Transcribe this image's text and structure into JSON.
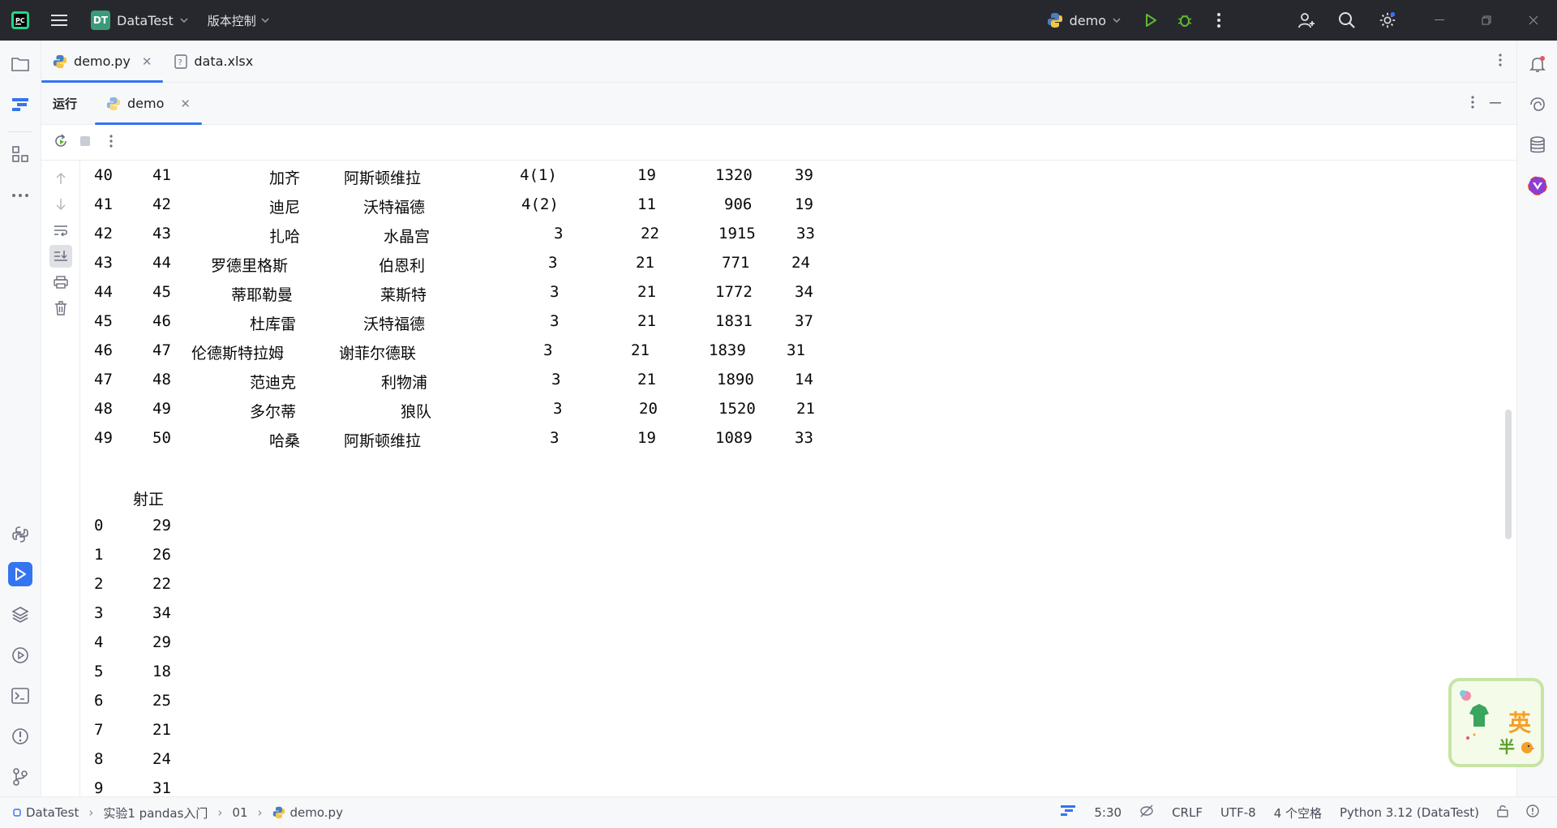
{
  "titlebar": {
    "project_badge": "DT",
    "project_name": "DataTest",
    "vcs_label": "版本控制",
    "run_config": "demo"
  },
  "editor_tabs": [
    {
      "label": "demo.py",
      "icon": "python-file-icon",
      "active": true
    },
    {
      "label": "data.xlsx",
      "icon": "unknown-file-icon",
      "active": false
    }
  ],
  "run_panel": {
    "title": "运行",
    "tab_label": "demo"
  },
  "console": {
    "table_rows": [
      {
        "idx": "40",
        "no": "41",
        "player": "加齐",
        "club": "阿斯顿维拉",
        "pos": "4(1)",
        "age": "19",
        "val": "1320",
        "last": "39"
      },
      {
        "idx": "41",
        "no": "42",
        "player": "迪尼",
        "club": "沃特福德",
        "pos": "4(2)",
        "age": "11",
        "val": "906",
        "last": "19"
      },
      {
        "idx": "42",
        "no": "43",
        "player": "扎哈",
        "club": "水晶宫",
        "pos": "3",
        "age": "22",
        "val": "1915",
        "last": "33"
      },
      {
        "idx": "43",
        "no": "44",
        "player": "罗德里格斯",
        "club": "伯恩利",
        "pos": "3",
        "age": "21",
        "val": "771",
        "last": "24"
      },
      {
        "idx": "44",
        "no": "45",
        "player": "蒂耶勒曼",
        "club": "莱斯特",
        "pos": "3",
        "age": "21",
        "val": "1772",
        "last": "34"
      },
      {
        "idx": "45",
        "no": "46",
        "player": "杜库雷",
        "club": "沃特福德",
        "pos": "3",
        "age": "21",
        "val": "1831",
        "last": "37"
      },
      {
        "idx": "46",
        "no": "47",
        "player": "伦德斯特拉姆",
        "club": "谢菲尔德联",
        "pos": "3",
        "age": "21",
        "val": "1839",
        "last": "31"
      },
      {
        "idx": "47",
        "no": "48",
        "player": "范迪克",
        "club": "利物浦",
        "pos": "3",
        "age": "21",
        "val": "1890",
        "last": "14"
      },
      {
        "idx": "48",
        "no": "49",
        "player": "多尔蒂",
        "club": "狼队",
        "pos": "3",
        "age": "20",
        "val": "1520",
        "last": "21"
      },
      {
        "idx": "49",
        "no": "50",
        "player": "哈桑",
        "club": "阿斯顿维拉",
        "pos": "3",
        "age": "19",
        "val": "1089",
        "last": "33"
      }
    ],
    "series_header": "射正",
    "series_rows": [
      {
        "idx": "0",
        "val": "29"
      },
      {
        "idx": "1",
        "val": "26"
      },
      {
        "idx": "2",
        "val": "22"
      },
      {
        "idx": "3",
        "val": "34"
      },
      {
        "idx": "4",
        "val": "29"
      },
      {
        "idx": "5",
        "val": "18"
      },
      {
        "idx": "6",
        "val": "25"
      },
      {
        "idx": "7",
        "val": "21"
      },
      {
        "idx": "8",
        "val": "24"
      },
      {
        "idx": "9",
        "val": "31"
      }
    ]
  },
  "statusbar": {
    "breadcrumb": [
      "DataTest",
      "实验1 pandas入门",
      "01",
      "demo.py"
    ],
    "position": "5:30",
    "line_ending": "CRLF",
    "encoding": "UTF-8",
    "indent": "4 个空格",
    "interpreter": "Python 3.12 (DataTest)"
  },
  "sticker": {
    "char1": "英",
    "char2": "半"
  },
  "colors": {
    "accent": "#3574f0",
    "titlebar_bg": "#27282e",
    "run_green": "#5fb832",
    "project_badge": "#3b9b78"
  }
}
